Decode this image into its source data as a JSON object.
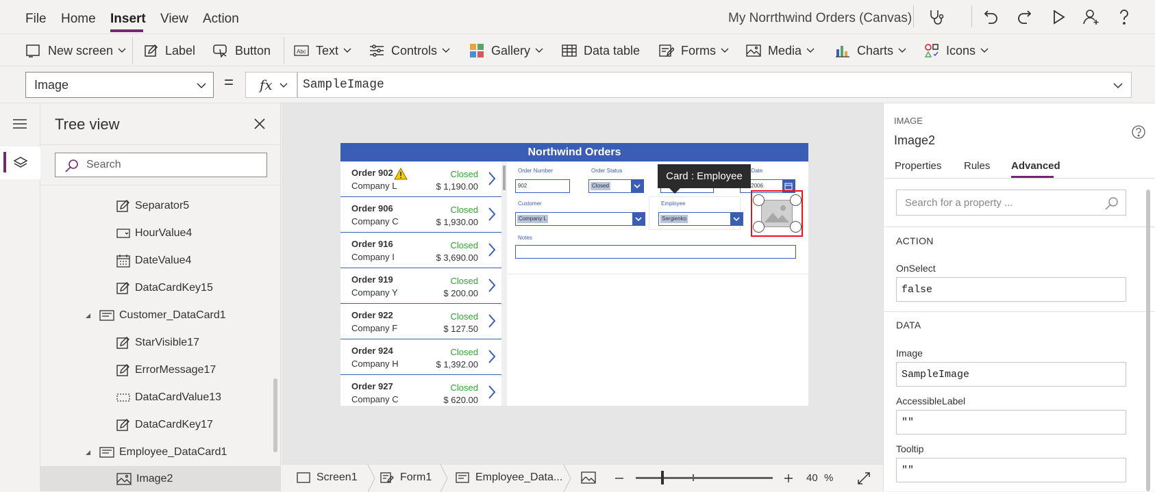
{
  "menubar": {
    "items": [
      "File",
      "Home",
      "Insert",
      "View",
      "Action"
    ],
    "active": "Insert",
    "app_title": "My Norrthwind Orders (Canvas)"
  },
  "ribbon": {
    "new_screen": "New screen",
    "label": "Label",
    "button": "Button",
    "text": "Text",
    "controls": "Controls",
    "gallery": "Gallery",
    "data_table": "Data table",
    "forms": "Forms",
    "media": "Media",
    "charts": "Charts",
    "icons": "Icons"
  },
  "formula_bar": {
    "property": "Image",
    "equals": "=",
    "fx": "fx",
    "formula": "SampleImage"
  },
  "tree_view": {
    "title": "Tree view",
    "search_placeholder": "Search",
    "items": [
      {
        "label": "Separator5",
        "icon": "edit-icon"
      },
      {
        "label": "HourValue4",
        "icon": "dropdown-control-icon"
      },
      {
        "label": "DateValue4",
        "icon": "calendar-icon"
      },
      {
        "label": "DataCardKey15",
        "icon": "edit-icon"
      },
      {
        "label": "Customer_DataCard1",
        "icon": "card-icon"
      },
      {
        "label": "StarVisible17",
        "icon": "edit-icon"
      },
      {
        "label": "ErrorMessage17",
        "icon": "edit-icon"
      },
      {
        "label": "DataCardValue13",
        "icon": "textbox-icon"
      },
      {
        "label": "DataCardKey17",
        "icon": "edit-icon"
      },
      {
        "label": "Employee_DataCard1",
        "icon": "card-icon"
      },
      {
        "label": "Image2",
        "icon": "image-icon"
      }
    ]
  },
  "app_preview": {
    "header": "Northwind Orders",
    "orders": [
      {
        "title": "Order 902",
        "company": "Company L",
        "status": "Closed",
        "amount": "$ 1,190.00",
        "warning": true
      },
      {
        "title": "Order 906",
        "company": "Company C",
        "status": "Closed",
        "amount": "$ 1,930.00"
      },
      {
        "title": "Order 916",
        "company": "Company I",
        "status": "Closed",
        "amount": "$ 3,690.00"
      },
      {
        "title": "Order 919",
        "company": "Company Y",
        "status": "Closed",
        "amount": "$ 200.00"
      },
      {
        "title": "Order 922",
        "company": "Company F",
        "status": "Closed",
        "amount": "$ 127.50"
      },
      {
        "title": "Order 924",
        "company": "Company H",
        "status": "Closed",
        "amount": "$ 1,392.00"
      },
      {
        "title": "Order 927",
        "company": "Company C",
        "status": "Closed",
        "amount": "$ 620.00"
      }
    ],
    "form": {
      "order_number_label": "Order Number",
      "order_number": "902",
      "order_status_label": "Order Status",
      "order_status": "Closed",
      "paid_date_label": "id Date",
      "paid_date": "21/2006",
      "customer_label": "Customer",
      "customer": "Company L",
      "employee_label": "Employee",
      "employee": "Sergienko",
      "notes_label": "Notes"
    },
    "tooltip": "Card : Employee"
  },
  "bottom_bar": {
    "screen": "Screen1",
    "form": "Form1",
    "card": "Employee_Data...",
    "zoom": "40",
    "zoom_unit": "%",
    "zoom_level": 0.4
  },
  "right_panel": {
    "control_type": "IMAGE",
    "control_name": "Image2",
    "tabs": [
      "Properties",
      "Rules",
      "Advanced"
    ],
    "active_tab": "Advanced",
    "search_placeholder": "Search for a property ...",
    "action_header": "ACTION",
    "onselect_label": "OnSelect",
    "onselect_value": "false",
    "data_header": "DATA",
    "image_label": "Image",
    "image_value": "SampleImage",
    "accessible_label": "AccessibleLabel",
    "accessible_value": "\"\"",
    "tooltip_label": "Tooltip",
    "tooltip_value": "\"\""
  },
  "colors": {
    "accent": "#742774",
    "app_blue": "#3b5db5",
    "status_green": "#2ea52e",
    "selection_red": "#e81123"
  }
}
